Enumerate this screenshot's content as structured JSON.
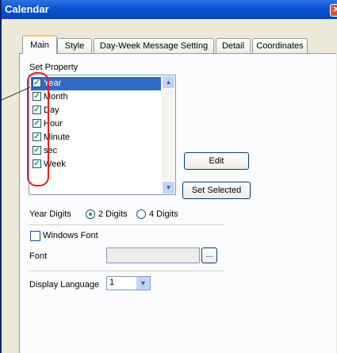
{
  "window": {
    "title": "Calendar"
  },
  "tabs": [
    "Main",
    "Style",
    "Day-Week Message Setting",
    "Detail",
    "Coordinates"
  ],
  "set_property": {
    "label": "Set Property",
    "items": [
      {
        "label": "Year",
        "checked": true,
        "selected": true
      },
      {
        "label": "Month",
        "checked": true
      },
      {
        "label": "Day",
        "checked": true
      },
      {
        "label": "Hour",
        "checked": true
      },
      {
        "label": "Minute",
        "checked": true
      },
      {
        "label": "sec",
        "checked": true
      },
      {
        "label": "Week",
        "checked": true
      }
    ]
  },
  "buttons": {
    "edit": "Edit",
    "set_selected": "Set Selected",
    "browse": "..."
  },
  "year_digits": {
    "label": "Year Digits",
    "option_2": "2 Digits",
    "option_4": "4 Digits",
    "selected": "2 Digits"
  },
  "windows_font": {
    "label": "Windows Font",
    "checked": false
  },
  "font": {
    "label": "Font",
    "value": ""
  },
  "display_language": {
    "label": "Display Language",
    "value": "1"
  },
  "colors": {
    "highlight": "#e0201d",
    "selection": "#316ac5",
    "titlebar": "#0a52d1"
  },
  "icons": {
    "close": "close-icon",
    "check": "check-icon",
    "dropdown": "chevron-down-icon"
  }
}
